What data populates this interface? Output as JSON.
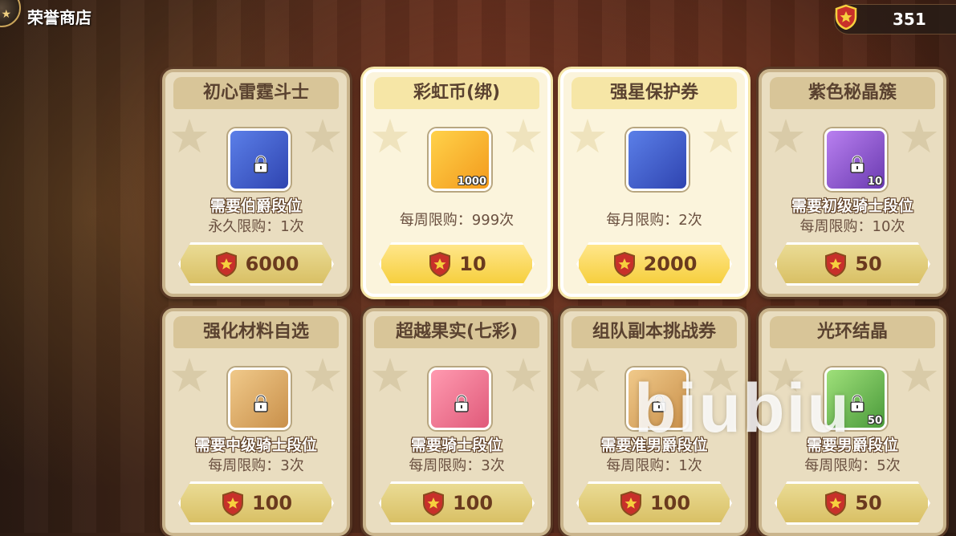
{
  "header": {
    "title": "荣誉商店",
    "currency_amount": "351",
    "currency_icon": "honor-shield-icon"
  },
  "colors": {
    "accent_gold": "#f6cf3e",
    "card_bg": "#e9ddc0",
    "price_text": "#6a3a1e"
  },
  "items": [
    {
      "name": "初心雷霆斗士",
      "qty": "",
      "requirement": "需要伯爵段位",
      "limit": "永久限购：1次",
      "price": "6000",
      "locked": true,
      "selected": false,
      "icon": "thunder-wings-icon"
    },
    {
      "name": "彩虹币(绑)",
      "qty": "1000",
      "requirement": "",
      "limit": "每周限购：999次",
      "price": "10",
      "locked": false,
      "selected": true,
      "icon": "rainbow-coin-icon"
    },
    {
      "name": "强星保护券",
      "qty": "",
      "requirement": "",
      "limit": "每月限购：2次",
      "price": "2000",
      "locked": false,
      "selected": true,
      "icon": "star-protect-ticket-icon"
    },
    {
      "name": "紫色秘晶簇",
      "qty": "10",
      "requirement": "需要初级骑士段位",
      "limit": "每周限购：10次",
      "price": "50",
      "locked": true,
      "selected": false,
      "icon": "purple-crystal-icon"
    },
    {
      "name": "强化材料自选",
      "qty": "",
      "requirement": "需要中级骑士段位",
      "limit": "每周限购：3次",
      "price": "100",
      "locked": true,
      "selected": false,
      "icon": "gift-box-icon"
    },
    {
      "name": "超越果实(七彩)",
      "qty": "",
      "requirement": "需要骑士段位",
      "limit": "每周限购：3次",
      "price": "100",
      "locked": true,
      "selected": false,
      "icon": "rainbow-fruit-icon"
    },
    {
      "name": "组队副本挑战券",
      "qty": "",
      "requirement": "需要准男爵段位",
      "limit": "每周限购：1次",
      "price": "100",
      "locked": true,
      "selected": false,
      "icon": "dungeon-ticket-icon"
    },
    {
      "name": "光环结晶",
      "qty": "50",
      "requirement": "需要男爵段位",
      "limit": "每周限购：5次",
      "price": "50",
      "locked": true,
      "selected": false,
      "icon": "aura-crystal-icon"
    }
  ],
  "watermark": "biubiu"
}
